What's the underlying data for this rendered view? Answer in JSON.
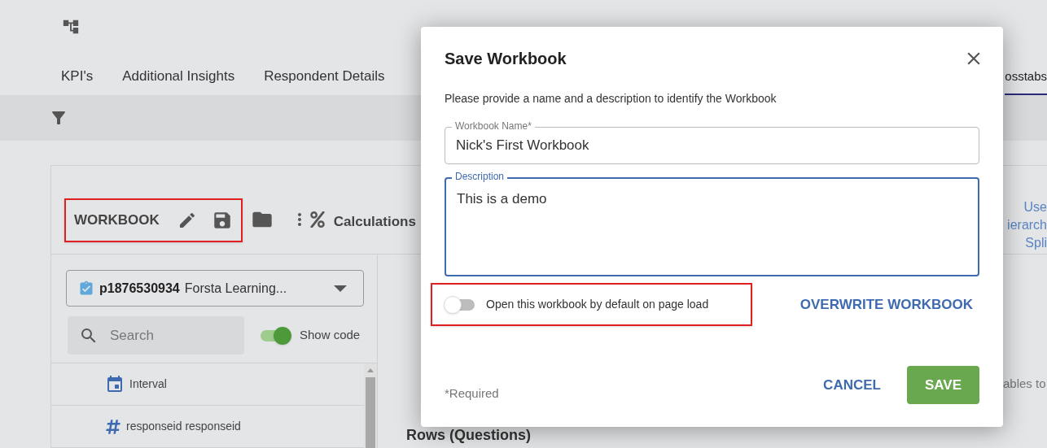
{
  "header": {
    "tabs": [
      {
        "label": "KPI's",
        "selected": false
      },
      {
        "label": "Additional Insights",
        "selected": false
      },
      {
        "label": "Respondent Details",
        "selected": false
      },
      {
        "label": "osstabs",
        "selected": true
      }
    ]
  },
  "toolbar": {
    "workbook_label": "WORKBOOK",
    "calculations_label": "Calculations",
    "side_fragments": [
      "Use",
      "ierarch",
      "Spli"
    ]
  },
  "dataset_selector": {
    "code": "p1876530934",
    "name": "Forsta Learning..."
  },
  "search": {
    "placeholder": "Search"
  },
  "show_code": {
    "label": "Show code",
    "on": true
  },
  "variables": [
    {
      "kind": "date",
      "label": "Interval"
    },
    {
      "kind": "numeric",
      "label": "responseid responseid"
    }
  ],
  "hint_fragment": "ables to",
  "rows_heading": "Rows (Questions)",
  "dialog": {
    "title": "Save Workbook",
    "instructions": "Please provide a name and a description to identify the Workbook",
    "fields": [
      {
        "kind": "single",
        "label": "Workbook Name*",
        "value": "Nick's First Workbook",
        "focused": false
      },
      {
        "kind": "multi",
        "label": "Description",
        "value": "This is a demo",
        "focused": true
      }
    ],
    "default_toggle": {
      "label": "Open this workbook by default on page load",
      "on": false
    },
    "overwrite_label": "OVERWRITE WORKBOOK",
    "required_note": "*Required",
    "buttons": [
      {
        "kind": "text",
        "label": "CANCEL"
      },
      {
        "kind": "primary",
        "label": "SAVE"
      }
    ]
  }
}
